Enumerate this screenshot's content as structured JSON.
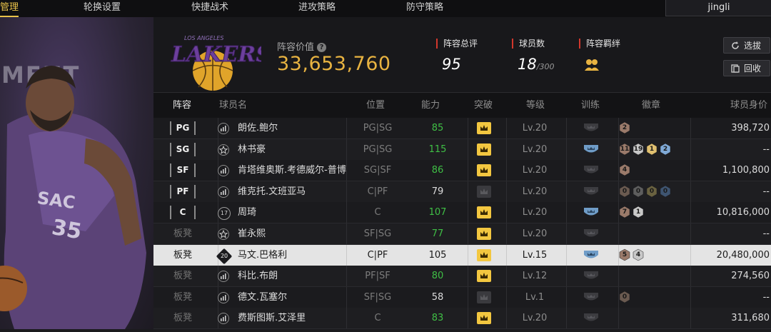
{
  "nav": {
    "tabs": [
      "管理",
      "轮换设置",
      "快捷战术",
      "进攻策略",
      "防守策略"
    ],
    "user": "jingli"
  },
  "art": {
    "letters": "MENT"
  },
  "team": {
    "logo_text": "LAKERS",
    "logo_subtext": "LOS ANGELES",
    "value_label": "阵容价值",
    "value": "33,653,760",
    "overall_label": "阵容总评",
    "overall": "95",
    "players_label": "球员数",
    "players": "18",
    "players_max": "/300",
    "bond_label": "阵容羁绊"
  },
  "buttons": {
    "pick": "选拔",
    "recycle": "回收"
  },
  "columns": [
    "阵容",
    "球员名",
    "位置",
    "能力",
    "突破",
    "等级",
    "训练",
    "徽章",
    "球员身价"
  ],
  "rows": [
    {
      "lineup": "PG",
      "icon": "signal",
      "name": "朗佐.鲍尔",
      "pos": "PG|SG",
      "ability": "85",
      "green": true,
      "breakthrough": "gold",
      "level": "Lv.20",
      "train": "grey",
      "badges": [
        {
          "n": "2",
          "c": "#9a7a6a"
        }
      ],
      "value": "398,720"
    },
    {
      "lineup": "SG",
      "icon": "star",
      "name": "林书豪",
      "pos": "PG|SG",
      "ability": "115",
      "green": true,
      "breakthrough": "gold",
      "level": "Lv.20",
      "train": "blue",
      "badges": [
        {
          "n": "11",
          "c": "#9a7a6a"
        },
        {
          "n": "19",
          "c": "#c8c8c8"
        },
        {
          "n": "1",
          "c": "#e0c070"
        },
        {
          "n": "2",
          "c": "#7fa9d6"
        }
      ],
      "value": "--"
    },
    {
      "lineup": "SF",
      "icon": "signal",
      "name": "肯塔维奥斯.考德威尔-普博",
      "pos": "SG|SF",
      "ability": "86",
      "green": true,
      "breakthrough": "gold",
      "level": "Lv.20",
      "train": "grey",
      "badges": [
        {
          "n": "4",
          "c": "#9a7a6a"
        }
      ],
      "value": "1,100,800"
    },
    {
      "lineup": "PF",
      "icon": "signal",
      "name": "维克托.文班亚马",
      "pos": "C|PF",
      "ability": "79",
      "green": false,
      "breakthrough": "grey",
      "level": "Lv.20",
      "train": "grey",
      "badges": [
        {
          "n": "0",
          "c": "#6a5a50"
        },
        {
          "n": "0",
          "c": "#5e5e5e"
        },
        {
          "n": "0",
          "c": "#6a6240"
        },
        {
          "n": "0",
          "c": "#3e5470"
        }
      ],
      "value": "--"
    },
    {
      "lineup": "C",
      "icon": "17",
      "name": "周琦",
      "pos": "C",
      "ability": "107",
      "green": true,
      "breakthrough": "gold",
      "level": "Lv.20",
      "train": "blue",
      "badges": [
        {
          "n": "7",
          "c": "#9a7a6a"
        },
        {
          "n": "1",
          "c": "#c8c8c8"
        }
      ],
      "value": "10,816,000"
    },
    {
      "lineup": "板凳",
      "icon": "star",
      "name": "崔永熙",
      "pos": "SF|SG",
      "ability": "77",
      "green": true,
      "breakthrough": "gold",
      "level": "Lv.20",
      "train": "grey",
      "badges": [],
      "value": "--"
    },
    {
      "lineup": "板凳",
      "icon": "20",
      "name": "马文.巴格利",
      "pos": "C|PF",
      "ability": "105",
      "green": false,
      "breakthrough": "gold",
      "level": "Lv.15",
      "train": "blue",
      "badges": [
        {
          "n": "5",
          "c": "#9a7a6a"
        },
        {
          "n": "4",
          "c": "#c8c8c8"
        }
      ],
      "value": "20,480,000",
      "selected": true
    },
    {
      "lineup": "板凳",
      "icon": "signal",
      "name": "科比.布朗",
      "pos": "PF|SF",
      "ability": "80",
      "green": true,
      "breakthrough": "gold",
      "level": "Lv.12",
      "train": "grey",
      "badges": [],
      "value": "274,560"
    },
    {
      "lineup": "板凳",
      "icon": "signal",
      "name": "德文.瓦塞尔",
      "pos": "SF|SG",
      "ability": "58",
      "green": false,
      "breakthrough": "grey",
      "level": "Lv.1",
      "train": "grey",
      "badges": [
        {
          "n": "0",
          "c": "#6a5a50"
        }
      ],
      "value": "--"
    },
    {
      "lineup": "板凳",
      "icon": "signal",
      "name": "费斯图斯.艾泽里",
      "pos": "C",
      "ability": "83",
      "green": true,
      "breakthrough": "gold",
      "level": "Lv.20",
      "train": "grey",
      "badges": [],
      "value": "311,680"
    }
  ],
  "colors": {
    "accent": "#e8b341",
    "green": "#3fbf45",
    "red": "#d2372c",
    "selected_row": "#e4e4e4"
  }
}
